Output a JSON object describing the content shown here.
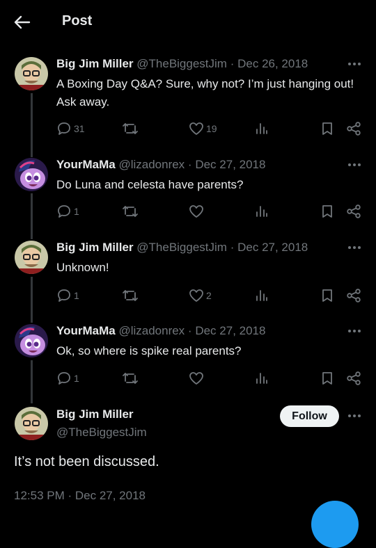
{
  "header": {
    "title": "Post"
  },
  "thread": [
    {
      "name": "Big Jim Miller",
      "handle": "@TheBiggestJim",
      "date": "Dec 26, 2018",
      "text": "A Boxing Day Q&A? Sure, why not? I’m just hanging out! Ask away.",
      "replies": "31",
      "retweets": "",
      "likes": "19",
      "avatar_icon": "cartoon-man-avatar"
    },
    {
      "name": "YourMaMa",
      "handle": "@lizadonrex",
      "date": "Dec 27, 2018",
      "text": "Do Luna and celesta have parents?",
      "replies": "1",
      "retweets": "",
      "likes": "",
      "avatar_icon": "purple-pony-avatar"
    },
    {
      "name": "Big Jim Miller",
      "handle": "@TheBiggestJim",
      "date": "Dec 27, 2018",
      "text": "Unknown!",
      "replies": "1",
      "retweets": "",
      "likes": "2",
      "avatar_icon": "cartoon-man-avatar"
    },
    {
      "name": "YourMaMa",
      "handle": "@lizadonrex",
      "date": "Dec 27, 2018",
      "text": "Ok, so where is spike real parents?",
      "replies": "1",
      "retweets": "",
      "likes": "",
      "avatar_icon": "purple-pony-avatar"
    }
  ],
  "main_post": {
    "name": "Big Jim Miller",
    "handle": "@TheBiggestJim",
    "follow_label": "Follow",
    "text": "It’s not been discussed.",
    "time": "12:53 PM · Dec 27, 2018"
  },
  "separator": "·",
  "colors": {
    "background": "#000000",
    "text": "#e7e9ea",
    "muted": "#71767b",
    "accent": "#1d9bf0",
    "follow_bg": "#eff3f4"
  }
}
